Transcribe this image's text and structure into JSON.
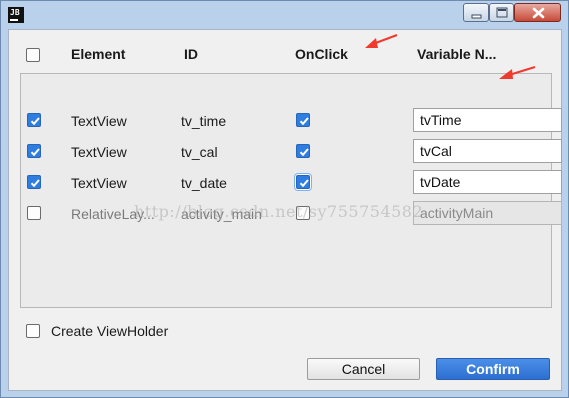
{
  "window": {
    "app_icon_text": "JB"
  },
  "header": {
    "element": "Element",
    "id": "ID",
    "onclick": "OnClick",
    "variable": "Variable N..."
  },
  "rows": [
    {
      "element": "TextView",
      "id": "tv_time",
      "variable": "tvTime",
      "row_checked": true,
      "onclick_checked": true,
      "enabled": true
    },
    {
      "element": "TextView",
      "id": "tv_cal",
      "variable": "tvCal",
      "row_checked": true,
      "onclick_checked": true,
      "enabled": true
    },
    {
      "element": "TextView",
      "id": "tv_date",
      "variable": "tvDate",
      "row_checked": true,
      "onclick_checked": true,
      "enabled": true
    },
    {
      "element": "RelativeLay...",
      "id": "activity_main",
      "variable": "activityMain",
      "row_checked": false,
      "onclick_checked": false,
      "enabled": false
    }
  ],
  "watermark": "http://blog.csdn.net/sy755754582",
  "options": {
    "create_viewholder": "Create ViewHolder",
    "create_viewholder_checked": false
  },
  "buttons": {
    "cancel": "Cancel",
    "confirm": "Confirm"
  },
  "colors": {
    "checkbox_checked": "#2f7de1",
    "confirm_button": "#2d6fd1",
    "annotation_arrow": "#f03a2e"
  }
}
